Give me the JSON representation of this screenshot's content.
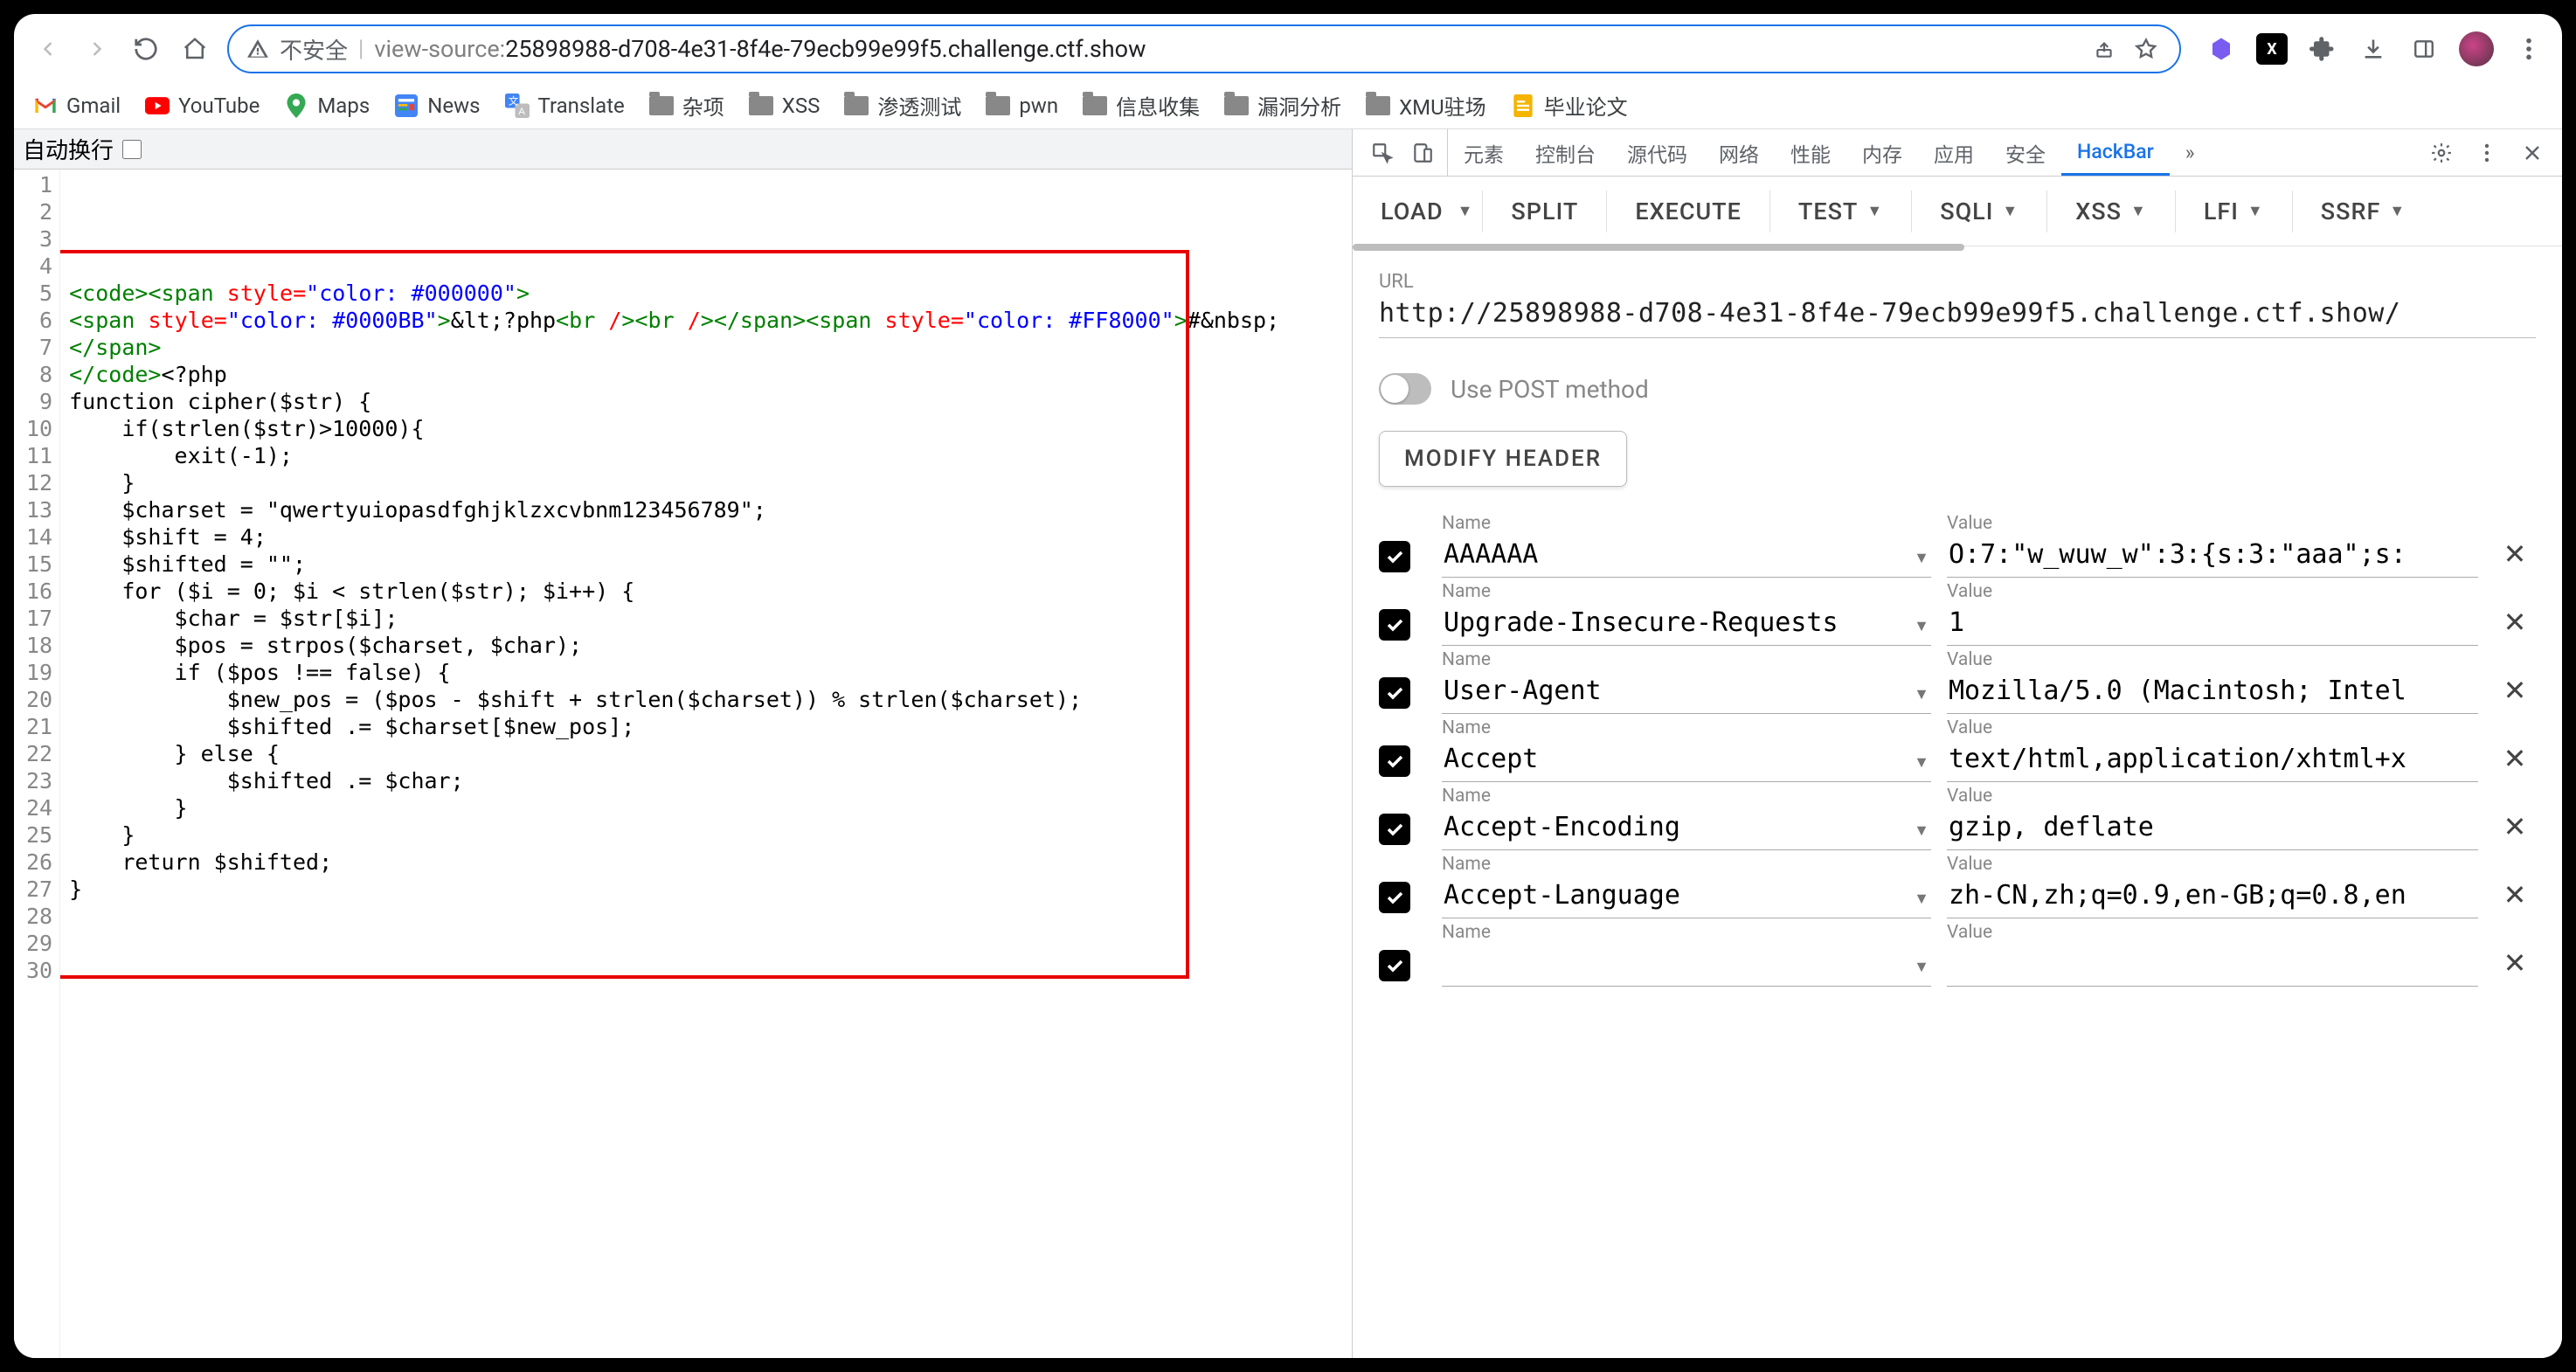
{
  "toolbar": {
    "insecure_label": "不安全",
    "url_prefix": "view-source:",
    "url_host": "25898988-d708-4e31-8f4e-79ecb99e99f5.challenge.ctf.show"
  },
  "bookmarks": [
    {
      "icon": "gmail",
      "label": "Gmail"
    },
    {
      "icon": "youtube",
      "label": "YouTube"
    },
    {
      "icon": "maps",
      "label": "Maps"
    },
    {
      "icon": "news",
      "label": "News"
    },
    {
      "icon": "translate",
      "label": "Translate"
    },
    {
      "icon": "folder",
      "label": "杂项"
    },
    {
      "icon": "folder",
      "label": "XSS"
    },
    {
      "icon": "folder",
      "label": "渗透测试"
    },
    {
      "icon": "folder",
      "label": "pwn"
    },
    {
      "icon": "folder",
      "label": "信息收集"
    },
    {
      "icon": "folder",
      "label": "漏洞分析"
    },
    {
      "icon": "folder",
      "label": "XMU驻场"
    },
    {
      "icon": "doc",
      "label": "毕业论文"
    }
  ],
  "autowrap_label": "自动换行",
  "source_lines": [
    {
      "n": 1
    },
    {
      "n": 2
    },
    {
      "n": 3
    },
    {
      "n": 4
    },
    {
      "n": 5
    },
    {
      "n": 6
    },
    {
      "n": 7
    },
    {
      "n": 8
    },
    {
      "n": 9
    },
    {
      "n": 10
    },
    {
      "n": 11
    },
    {
      "n": 12
    },
    {
      "n": 13
    },
    {
      "n": 14
    },
    {
      "n": 15
    },
    {
      "n": 16
    },
    {
      "n": 17
    },
    {
      "n": 18
    },
    {
      "n": 19
    },
    {
      "n": 20
    },
    {
      "n": 21
    },
    {
      "n": 22
    },
    {
      "n": 23
    },
    {
      "n": 24
    },
    {
      "n": 25
    },
    {
      "n": 26
    },
    {
      "n": 27
    },
    {
      "n": 28
    },
    {
      "n": 29
    },
    {
      "n": 30
    }
  ],
  "code": {
    "l1": "<code><span style=\"color: #000000\">",
    "l2a": "<span style=\"color: #0000BB\">",
    "l2b": "&lt;?php",
    "l2c": "<br /><br />",
    "l2d": "</span><span style=\"color: #FF8000\">",
    "l2e": "#&nbsp;",
    "l3": "</span>",
    "l4a": "</code>",
    "l4b": "<?php",
    "l5": "",
    "l6": "function cipher($str) {",
    "l7": "",
    "l8": "    if(strlen($str)>10000){",
    "l9": "        exit(-1);",
    "l10": "    }",
    "l11": "",
    "l12": "    $charset = \"qwertyuiopasdfghjklzxcvbnm123456789\";",
    "l13": "    $shift = 4;",
    "l14": "    $shifted = \"\";",
    "l15": "",
    "l16": "    for ($i = 0; $i < strlen($str); $i++) {",
    "l17": "        $char = $str[$i];",
    "l18": "        $pos = strpos($charset, $char);",
    "l19": "",
    "l20": "        if ($pos !== false) {",
    "l21": "            $new_pos = ($pos - $shift + strlen($charset)) % strlen($charset);",
    "l22": "            $shifted .= $charset[$new_pos];",
    "l23": "        } else {",
    "l24": "            $shifted .= $char;",
    "l25": "        }",
    "l26": "    }",
    "l27": "",
    "l28": "    return $shifted;",
    "l29": "}",
    "l30": ""
  },
  "devtools_tabs": {
    "elements": "元素",
    "console": "控制台",
    "sources": "源代码",
    "network": "网络",
    "performance": "性能",
    "memory": "内存",
    "application": "应用",
    "security": "安全",
    "hackbar": "HackBar",
    "more": "»"
  },
  "hackbar": {
    "actions": {
      "load": "LOAD",
      "split": "SPLIT",
      "execute": "EXECUTE",
      "test": "TEST",
      "sqli": "SQLI",
      "xss": "XSS",
      "lfi": "LFI",
      "ssrf": "SSRF"
    },
    "url_label": "URL",
    "url_value": "http://25898988-d708-4e31-8f4e-79ecb99e99f5.challenge.ctf.show/",
    "use_post_label": "Use POST method",
    "modify_header_label": "MODIFY HEADER",
    "name_label": "Name",
    "value_label": "Value",
    "headers": [
      {
        "name": "AAAAAA",
        "value": "O:7:\"w_wuw_w\":3:{s:3:\"aaa\";s:"
      },
      {
        "name": "Upgrade-Insecure-Requests",
        "value": "1"
      },
      {
        "name": "User-Agent",
        "value": "Mozilla/5.0 (Macintosh; Intel"
      },
      {
        "name": "Accept",
        "value": "text/html,application/xhtml+x"
      },
      {
        "name": "Accept-Encoding",
        "value": "gzip, deflate"
      },
      {
        "name": "Accept-Language",
        "value": "zh-CN,zh;q=0.9,en-GB;q=0.8,en"
      },
      {
        "name": "",
        "value": ""
      }
    ]
  }
}
